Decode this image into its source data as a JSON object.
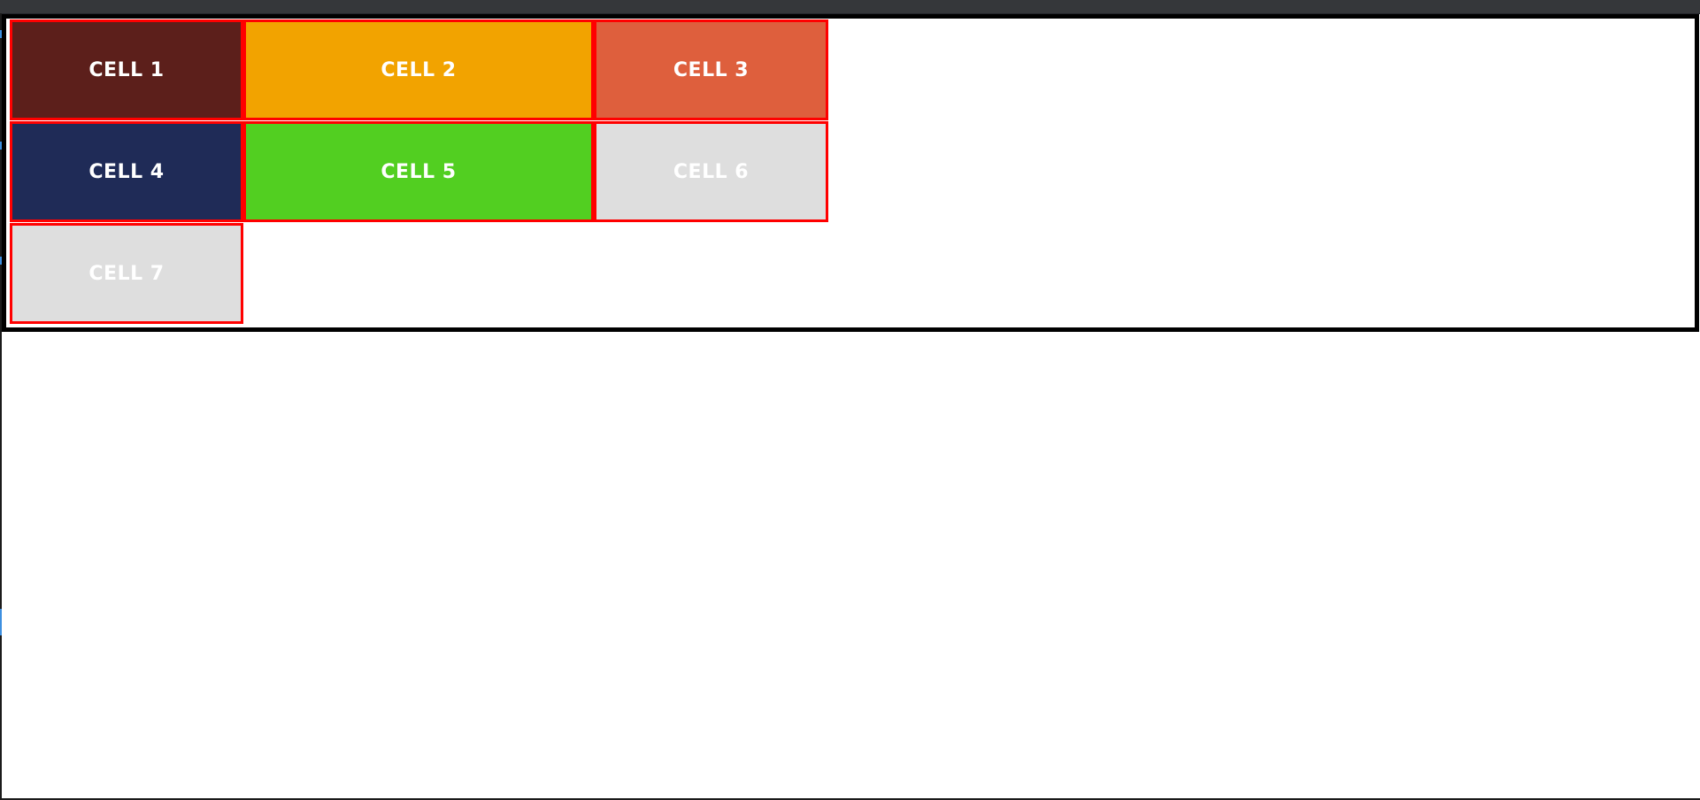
{
  "cells": [
    {
      "label": "CELL 1",
      "bg": "#5c1f1b"
    },
    {
      "label": "CELL 2",
      "bg": "#f2a300"
    },
    {
      "label": "CELL 3",
      "bg": "#de5f3d"
    },
    {
      "label": "CELL 4",
      "bg": "#1f2b57"
    },
    {
      "label": "CELL 5",
      "bg": "#52cf21"
    },
    {
      "label": "CELL 6",
      "bg": "#dedede"
    },
    {
      "label": "CELL 7",
      "bg": "#dedede"
    }
  ],
  "colors": {
    "cell_border": "#ff0000",
    "container_border": "#000000",
    "cell_text": "#ffffff",
    "top_bar": "#35373a"
  }
}
